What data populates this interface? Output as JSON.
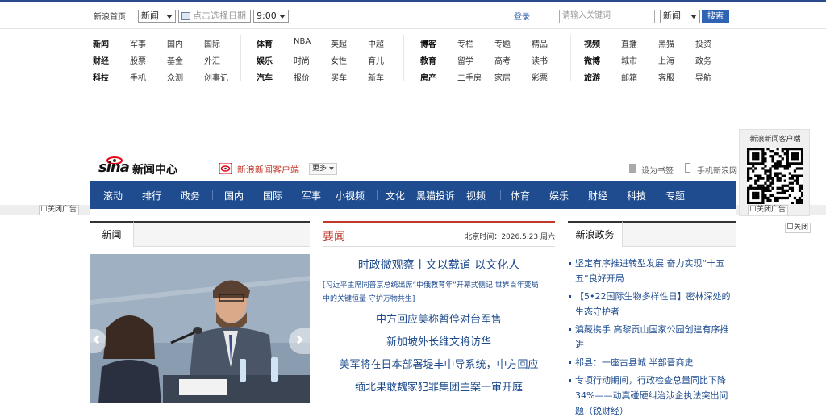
{
  "topbar": {
    "home_label": "新浪首页",
    "channel_select": "新闻",
    "date_placeholder": "点击选择日期",
    "time_select": "9:00",
    "login_label": "登录",
    "search_placeholder": "请输入关键词",
    "search_scope": "新闻",
    "search_button": "搜索"
  },
  "channel_nav": {
    "group1": [
      [
        "新闻",
        "军事",
        "国内",
        "国际"
      ],
      [
        "财经",
        "股票",
        "基金",
        "外汇"
      ],
      [
        "科技",
        "手机",
        "众测",
        "创事记"
      ]
    ],
    "group2": [
      [
        "体育",
        "NBA",
        "英超",
        "中超"
      ],
      [
        "娱乐",
        "时尚",
        "女性",
        "育儿"
      ],
      [
        "汽车",
        "报价",
        "买车",
        "新车"
      ]
    ],
    "group3": [
      [
        "博客",
        "专栏",
        "专题",
        "精品"
      ],
      [
        "教育",
        "留学",
        "高考",
        "读书"
      ],
      [
        "房产",
        "二手房",
        "家居",
        "彩票"
      ]
    ],
    "group4": [
      [
        "视频",
        "直播",
        "黑猫",
        "投资"
      ],
      [
        "微博",
        "城市",
        "上海",
        "政务"
      ],
      [
        "旅游",
        "邮箱",
        "客服",
        "导航"
      ]
    ]
  },
  "qr_popup": {
    "title": "新浪新闻客户端",
    "close_label": "关闭"
  },
  "ad_close_left": "关闭广告",
  "ad_close_right": "关闭广告",
  "brand": {
    "logo_text": "sina",
    "center_text": "新闻中心",
    "client_link": "新浪新闻客户端",
    "more_label": "更多",
    "bookmark_label": "设为书签",
    "mobile_label": "手机新浪网"
  },
  "main_nav": [
    "滚动",
    "排行",
    "政务",
    "国内",
    "国际",
    "军事",
    "小视频",
    "文化",
    "黑猫投诉",
    "视频",
    "体育",
    "娱乐",
    "财经",
    "科技",
    "专题"
  ],
  "left_col": {
    "tab_label": "新闻"
  },
  "center_col": {
    "heading": "要闻",
    "clock_label": "北京时间：2026.5.23 周六",
    "headline": "时政微观察丨文以载道 以文化人",
    "summary_line1": "[习近平主席同普京总统出席“中俄教育年”开幕式侧记 世界百年变局",
    "summary_line2": "中的关键恒量 守护万物共生]",
    "stories": [
      "中方回应美称暂停对台军售",
      "新加坡外长维文将访华",
      "美军将在日本部署堤丰中导系统，中方回应",
      "缅北果敢魏家犯罪集团主案一审开庭"
    ]
  },
  "right_col": {
    "tab_label": "新浪政务",
    "items": [
      [
        "坚定有序推进转型发展 奋力实现“十五",
        "五”良好开局"
      ],
      [
        "【5•22国际生物多样性日】密林深处的",
        "生态守护者"
      ],
      [
        "滇藏携手 高黎贡山国家公园创建有序推",
        "进"
      ],
      [
        "祁县：一座古县城 半部晋商史"
      ],
      [
        "专项行动期间，行政检查总量同比下降",
        "34%——动真碰硬纠治涉企执法突出问",
        "题（锐财经）"
      ]
    ]
  },
  "colors": {
    "brand_blue": "#1e4c8f",
    "link_blue": "#1d4b8e",
    "accent_red": "#c0392b",
    "logo_red": "#e60012"
  }
}
